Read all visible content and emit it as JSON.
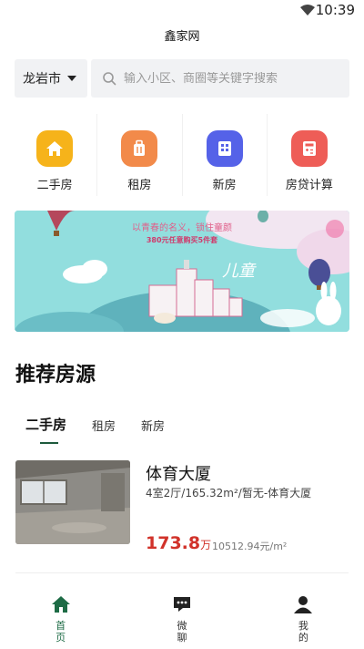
{
  "status_bar": {
    "time": "10:39"
  },
  "app": {
    "title": "鑫家网"
  },
  "search": {
    "city": "龙岩市",
    "placeholder": "输入小区、商圈等关键字搜索"
  },
  "quick_menu": [
    {
      "label": "二手房",
      "icon": "home-icon",
      "color": "#f6b31a"
    },
    {
      "label": "租房",
      "icon": "luggage-icon",
      "color": "#f28a4a"
    },
    {
      "label": "新房",
      "icon": "building-icon",
      "color": "#5562e8"
    },
    {
      "label": "房贷计算",
      "icon": "calculator-icon",
      "color": "#ee5d57"
    }
  ],
  "banner": {
    "line1": "以青春的名义，锁住童颜",
    "line2": "380元任意购买5件套",
    "brand": "儿童"
  },
  "recommend": {
    "title": "推荐房源",
    "tabs": [
      {
        "label": "二手房",
        "active": true
      },
      {
        "label": "租房",
        "active": false
      },
      {
        "label": "新房",
        "active": false
      }
    ]
  },
  "listings": [
    {
      "title": "体育大厦",
      "desc": "4室2厅/165.32m²/暂无-体育大厦",
      "price": "173.8",
      "price_unit": "万",
      "unit_price": "10512.94元/m²"
    }
  ],
  "bottom_nav": [
    {
      "label": "首页",
      "icon": "home-icon",
      "active": true
    },
    {
      "label": "微聊",
      "icon": "chat-icon",
      "active": false
    },
    {
      "label": "我的",
      "icon": "user-icon",
      "active": false
    }
  ],
  "colors": {
    "accent": "#1d6b45",
    "price": "#d1322a"
  }
}
